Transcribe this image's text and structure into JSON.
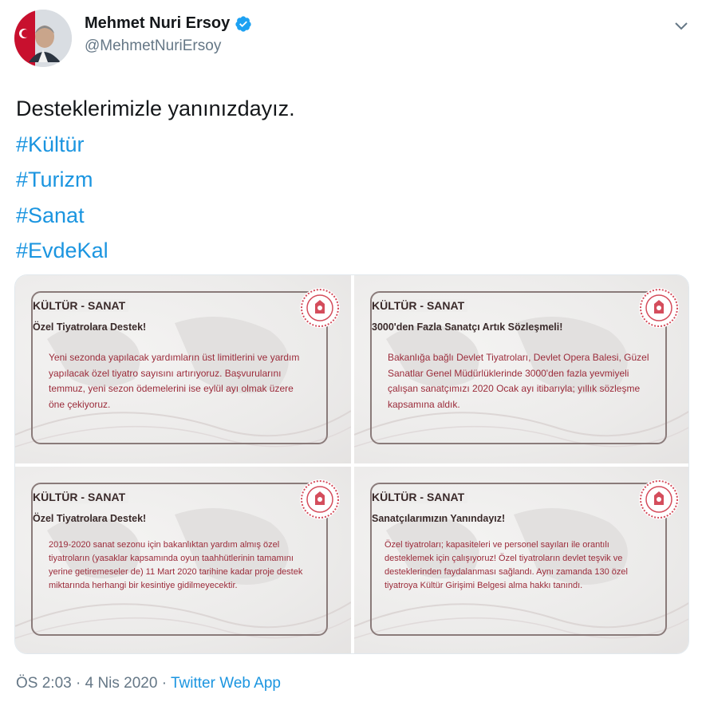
{
  "author": {
    "display_name": "Mehmet Nuri Ersoy",
    "handle": "@MehmetNuriErsoy",
    "verified_icon": "verified-badge-icon",
    "colors": {
      "verified": "#1da1f2"
    }
  },
  "tweet": {
    "text": "Desteklerimizle yanınızdayız.",
    "hashtags": [
      "#Kültür",
      "#Turizm",
      "#Sanat",
      "#EvdeKal"
    ],
    "colors": {
      "hashtag": "#1b95e0"
    }
  },
  "media": {
    "cards": [
      {
        "category": "KÜLTÜR - SANAT",
        "title": "Özel Tiyatrolara Destek!",
        "body": "Yeni sezonda yapılacak yardımların üst limitlerini ve yardım yapılacak özel tiyatro sayısını artırıyoruz. Başvurularını temmuz, yeni sezon ödemelerini ise eylül ayı olmak üzere öne çekiyoruz."
      },
      {
        "category": "KÜLTÜR - SANAT",
        "title": "3000'den Fazla Sanatçı Artık Sözleşmeli!",
        "body": "Bakanlığa bağlı Devlet Tiyatroları, Devlet Opera Balesi, Güzel Sanatlar Genel Müdürlüklerinde 3000'den fazla yevmiyeli çalışan sanatçımızı 2020 Ocak ayı itibarıyla; yıllık sözleşme kapsamına aldık."
      },
      {
        "category": "KÜLTÜR - SANAT",
        "title": "Özel Tiyatrolara Destek!",
        "body": "2019-2020 sanat sezonu için bakanlıktan yardım almış özel tiyatroların (yasaklar kapsamında oyun taahhütlerinin tamamını yerine getiremeseler de) 11 Mart 2020 tarihine kadar proje destek miktarında herhangi bir kesintiye gidilmeyecektir."
      },
      {
        "category": "KÜLTÜR - SANAT",
        "title": "Sanatçılarımızın Yanındayız!",
        "body": "Özel tiyatroları; kapasiteleri ve personel sayıları ile orantılı desteklemek için çalışıyoruz! Özel tiyatroların devlet teşvik ve desteklerinden faydalanması sağlandı. Aynı zamanda 130 özel tiyatroya Kültür Girişimi Belgesi alma hakkı tanındı."
      }
    ],
    "colors": {
      "body_text": "#9b2b3a",
      "heading": "#3a2a2a",
      "frame": "#8a7b7a"
    }
  },
  "meta": {
    "time": "ÖS 2:03",
    "separator": "·",
    "date": "4 Nis 2020",
    "source": "Twitter Web App"
  }
}
